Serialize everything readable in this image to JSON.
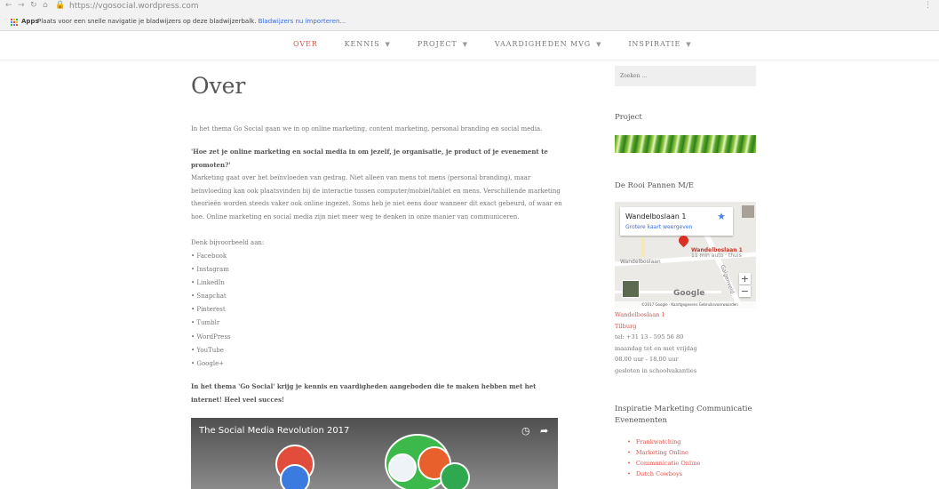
{
  "browser": {
    "url": "https://vgosocial.wordpress.com",
    "apps_label": "Apps",
    "bookmarks_message": "Plaats voor een snelle navigatie je bladwijzers op deze bladwijzerbalk.",
    "bookmarks_import": "Bladwijzers nu importeren..."
  },
  "menu": {
    "items": [
      {
        "label": "OVER",
        "has_caret": false,
        "active": true
      },
      {
        "label": "KENNIS",
        "has_caret": true
      },
      {
        "label": "PROJECT",
        "has_caret": true
      },
      {
        "label": "VAARDIGHEDEN MVG",
        "has_caret": true
      },
      {
        "label": "INSPIRATIE",
        "has_caret": true
      }
    ],
    "caret": "▼"
  },
  "main": {
    "title": "Over",
    "intro": "In het thema Go Social gaan we in op online marketing, content marketing, personal branding en social media.",
    "question": "'Hoe zet je online marketing en social media in om jezelf, je organisatie, je product of je evenement te promoten?'",
    "body": "Marketing gaat over het beïnvloeden van gedrag. Niet alleen van mens tot mens (personal branding), maar beïnvloeding kan ook plaatsvinden bij de interactie tussen computer/mobiel/tablet en mens. Verschillende marketing theorieën worden steeds vaker ook online ingezet. Soms heb je niet eens door wanneer dit exact gebeurd, of waar en hoe. Online marketing en social media zijn niet meer weg te denken in onze manier van communiceren.",
    "example_label": "Denk bijvoorbeeld aan:",
    "examples": [
      "• Facebook",
      "• Instagram",
      "• LinkedIn",
      "• Snapchat",
      "• Pinterest",
      "• Tumblr",
      "• WordPress",
      "• YouTube",
      "• Google+"
    ],
    "outro": "In het thema 'Go Social' krijg je kennis en vaardigheden aangeboden die te maken hebben met het internet! Heel veel succes!",
    "video_title": "The Social Media Revolution 2017"
  },
  "sidebar": {
    "search_placeholder": "Zoeken …",
    "project_title": "Project",
    "company_title": "De Rooi Pannen M/E",
    "map": {
      "address": "Wandelboslaan 1",
      "larger_map": "Grotere kaart weergeven",
      "pin_label": "Wandelboslaan 1",
      "pin_sub": "11 min auto · thuis",
      "street_1": "Wandelboslaan",
      "street_2": "Galgenveld",
      "google": "Google",
      "footer": "©2017 Google · Kaartgegevens   Gebruiksvoorwaarden"
    },
    "contact": {
      "street": "Wandelboslaan 1",
      "city": "Tilburg",
      "phone": "tel: +31 13 - 595 56 80",
      "days": "maandag tot en met vrijdag",
      "hours": "08.00 uur - 18.00 uur",
      "closed": "gesloten in schoolvakanties"
    },
    "inspiration_title": "Inspiratie Marketing Communicatie Evenementen",
    "links": [
      "Frankwatching",
      "Marketing Online",
      "Communicatie Online",
      "Dutch Cowboys"
    ]
  }
}
